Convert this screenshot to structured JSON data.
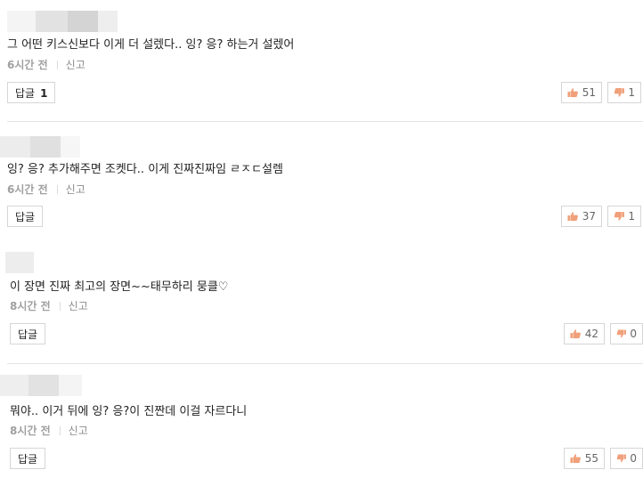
{
  "comments": [
    {
      "text": "그 어떤 키스신보다 이게 더 설렜다.. 잉? 응? 하는거 설렜어",
      "time": "6시간 전",
      "report": "신고",
      "reply_label": "답글",
      "reply_count": "1",
      "likes": "51",
      "dislikes": "1"
    },
    {
      "text": "잉? 응? 추가해주면 조켓다.. 이게 진짜진짜임 ㄹㅈㄷ설렘",
      "time": "6시간 전",
      "report": "신고",
      "reply_label": "답글",
      "likes": "37",
      "dislikes": "1"
    },
    {
      "text": "이 장면 진짜 최고의 장면~~태무하리 뭉클♡",
      "time": "8시간 전",
      "report": "신고",
      "reply_label": "답글",
      "likes": "42",
      "dislikes": "0"
    },
    {
      "text": "뭐야.. 이거 뒤에 잉? 응?이 진짠데 이걸 자르다니",
      "time": "8시간 전",
      "report": "신고",
      "reply_label": "답글",
      "likes": "55",
      "dislikes": "0"
    }
  ],
  "icons": {
    "like": "thumbs-up-icon",
    "dislike": "thumbs-down-icon"
  },
  "colors": {
    "thumb_up": "#f0a07a",
    "thumb_down": "#f0a07a",
    "meta_text": "#8c8c8c",
    "border": "#d6d6d6"
  }
}
